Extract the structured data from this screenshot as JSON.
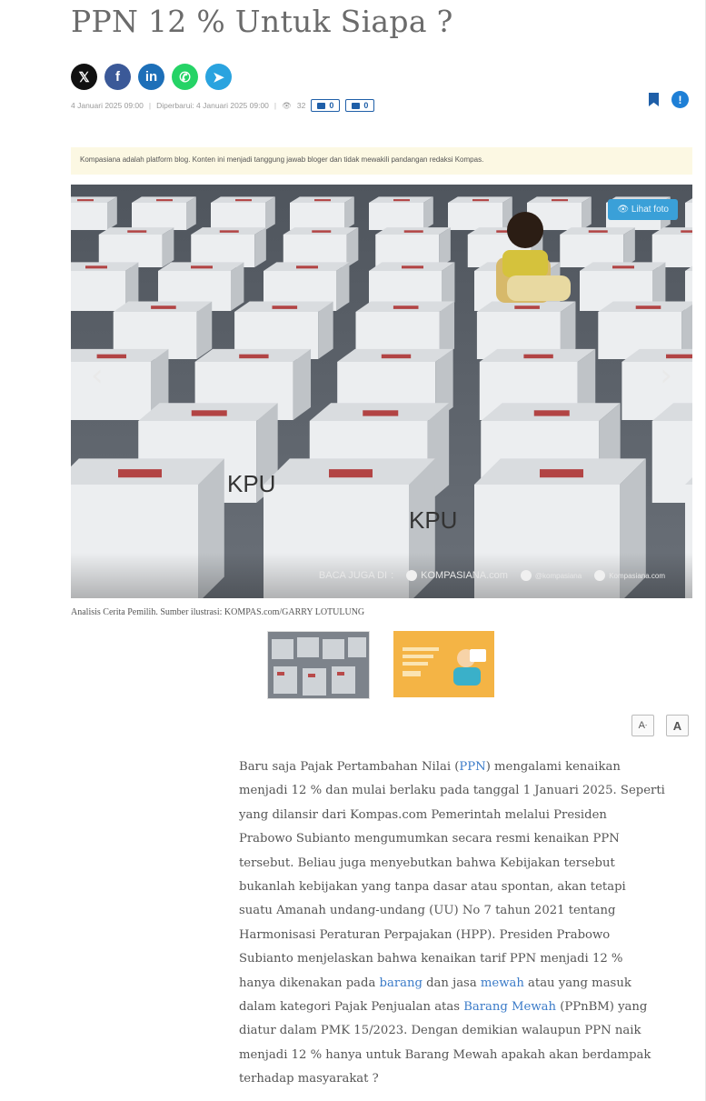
{
  "article": {
    "title": "PPN 12 % Untuk Siapa ?",
    "meta": {
      "published": "4 Januari 2025 09:00",
      "updated": "Diperbarui: 4 Januari 2025 09:00",
      "views": "32",
      "votes": "0",
      "comments": "0"
    },
    "disclaimer": "Kompasiana adalah platform blog. Konten ini menjadi tanggung jawab bloger dan tidak mewakili pandangan redaksi Kompas.",
    "image": {
      "lihat_foto": "Lihat foto",
      "baca_juga": "BACA JUGA DI",
      "site": "KOMPASIANA.com",
      "twitter": "@kompasiana",
      "instagram": "Kompasiana.com",
      "box_label": "KPU"
    },
    "caption": "Analisis Cerita Pemilih. Sumber ilustrasi: KOMPAS.com/GARRY LOTULUNG",
    "font_buttons": {
      "decrease": "A",
      "increase": "A"
    },
    "body_lines": [
      [
        {
          "t": "Baru saja Pajak Pertambahan Nilai ("
        },
        {
          "t": "PPN",
          "link": true
        },
        {
          "t": ") mengalami kenaikan"
        }
      ],
      [
        {
          "t": "menjadi 12 % dan mulai berlaku pada tanggal 1 Januari 2025. Seperti"
        }
      ],
      [
        {
          "t": "yang dilansir dari Kompas.com Pemerintah melalui Presiden"
        }
      ],
      [
        {
          "t": "Prabowo Subianto mengumumkan secara resmi kenaikan PPN"
        }
      ],
      [
        {
          "t": "tersebut. Beliau juga menyebutkan bahwa Kebijakan tersebut"
        }
      ],
      [
        {
          "t": "bukanlah kebijakan yang tanpa dasar atau spontan, akan tetapi"
        }
      ],
      [
        {
          "t": "suatu Amanah undang-undang (UU) No 7 tahun 2021 tentang"
        }
      ],
      [
        {
          "t": "Harmonisasi Peraturan Perpajakan (HPP). Presiden Prabowo"
        }
      ],
      [
        {
          "t": "Subianto menjelaskan bahwa kenaikan tarif PPN menjadi 12 %"
        }
      ],
      [
        {
          "t": "hanya dikenakan pada "
        },
        {
          "t": "barang",
          "link": true
        },
        {
          "t": " dan jasa "
        },
        {
          "t": "mewah",
          "link": true
        },
        {
          "t": " atau yang masuk"
        }
      ],
      [
        {
          "t": "dalam kategori Pajak Penjualan atas "
        },
        {
          "t": "Barang Mewah",
          "link": true
        },
        {
          "t": " (PPnBM) yang"
        }
      ],
      [
        {
          "t": "diatur dalam PMK 15/2023. Dengan demikian walaupun PPN naik"
        }
      ],
      [
        {
          "t": "menjadi 12 % hanya untuk Barang Mewah apakah akan berdampak"
        }
      ],
      [
        {
          "t": "terhadap masyarakat ?"
        }
      ]
    ]
  },
  "share_buttons": [
    {
      "name": "x-share-button",
      "icon": "x-icon",
      "glyph": "𝕏",
      "color": "#111111"
    },
    {
      "name": "facebook-share-button",
      "icon": "facebook-icon",
      "glyph": "f",
      "color": "#3b5998"
    },
    {
      "name": "linkedin-share-button",
      "icon": "linkedin-icon",
      "glyph": "in",
      "color": "#1d6fb8"
    },
    {
      "name": "whatsapp-share-button",
      "icon": "whatsapp-icon",
      "glyph": "✆",
      "color": "#25d366"
    },
    {
      "name": "telegram-share-button",
      "icon": "telegram-icon",
      "glyph": "➤",
      "color": "#2aa3df"
    }
  ],
  "colors": {
    "accent": "#1f5fa8",
    "link": "#3b7bc8",
    "disclaimer_bg": "#fcf8e3"
  }
}
